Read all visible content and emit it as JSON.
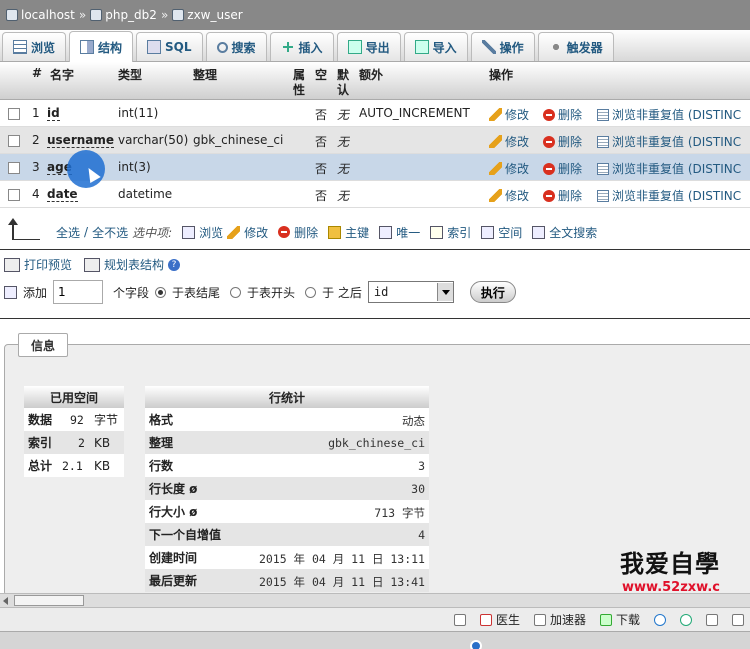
{
  "breadcrumb": [
    "localhost",
    "php_db2",
    "zxw_user"
  ],
  "breadcrumb_sep": "»",
  "tabs": [
    {
      "label": "浏览",
      "icon": "browse-icon"
    },
    {
      "label": "结构",
      "icon": "structure-icon",
      "active": true
    },
    {
      "label": "SQL",
      "icon": "sql-icon"
    },
    {
      "label": "搜索",
      "icon": "search-icon"
    },
    {
      "label": "插入",
      "icon": "insert-icon"
    },
    {
      "label": "导出",
      "icon": "export-icon"
    },
    {
      "label": "导入",
      "icon": "import-icon"
    },
    {
      "label": "操作",
      "icon": "wrench-icon"
    },
    {
      "label": "触发器",
      "icon": "trigger-icon"
    }
  ],
  "columns": {
    "num": "#",
    "name": "名字",
    "type": "类型",
    "collation": "整理",
    "attr1": "属",
    "attr2": "性",
    "null": "空",
    "def1": "默",
    "def2": "认",
    "extra": "额外",
    "action": "操作"
  },
  "rows": [
    {
      "num": "1",
      "name": "id",
      "type": "int(11)",
      "collation": "",
      "null": "否",
      "default": "无",
      "extra": "AUTO_INCREMENT"
    },
    {
      "num": "2",
      "name": "username",
      "type": "varchar(50)",
      "collation": "gbk_chinese_ci",
      "null": "否",
      "default": "无",
      "extra": ""
    },
    {
      "num": "3",
      "name": "age",
      "type": "int(3)",
      "collation": "",
      "null": "否",
      "default": "无",
      "extra": ""
    },
    {
      "num": "4",
      "name": "date",
      "type": "datetime",
      "collation": "",
      "null": "否",
      "default": "无",
      "extra": ""
    }
  ],
  "row_actions": {
    "edit": "修改",
    "delete": "删除",
    "distinct": "浏览非重复值 (DISTINC"
  },
  "bulk": {
    "check_all": "全选",
    "slash": "/",
    "uncheck_all": "全不选",
    "with_selected": "选中项:",
    "browse": "浏览",
    "edit": "修改",
    "delete": "删除",
    "primary": "主键",
    "unique": "唯一",
    "index": "索引",
    "spatial": "空间",
    "fulltext": "全文搜索"
  },
  "print_view": "打印预览",
  "propose_structure": "规划表结构",
  "add": {
    "label": "添加",
    "count": "1",
    "fields_label": "个字段",
    "opt_end": "于表结尾",
    "opt_begin": "于表开头",
    "opt_after": "于 之后",
    "after_field": "id",
    "go": "执行"
  },
  "info": {
    "legend": "信息",
    "space": {
      "title": "已用空间",
      "rows": [
        {
          "k": "数据",
          "v": "92",
          "u": "字节"
        },
        {
          "k": "索引",
          "v": "2",
          "u": "KB"
        },
        {
          "k": "总计",
          "v": "2.1",
          "u": "KB"
        }
      ]
    },
    "stats": {
      "title": "行统计",
      "rows": [
        {
          "k": "格式",
          "v": "动态"
        },
        {
          "k": "整理",
          "v": "gbk_chinese_ci"
        },
        {
          "k": "行数",
          "v": "3"
        },
        {
          "k": "行长度 ø",
          "v": "30"
        },
        {
          "k": "行大小 ø",
          "v": "713 字节"
        },
        {
          "k": "下一个自增值",
          "v": "4"
        },
        {
          "k": "创建时间",
          "v": "2015 年 04 月 11 日 13:11"
        },
        {
          "k": "最后更新",
          "v": "2015 年 04 月 11 日 13:41"
        }
      ]
    }
  },
  "watermark": {
    "text": "我爱自學",
    "url": "www.52zxw.c"
  },
  "statusbar": {
    "doctor": "医生",
    "accelerator": "加速器",
    "download": "下载"
  }
}
